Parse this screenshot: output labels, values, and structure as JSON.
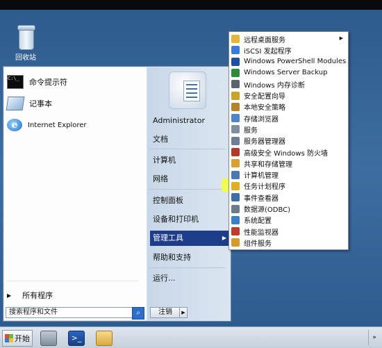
{
  "desktop": {
    "recycle_bin_label": "回收站"
  },
  "start_menu": {
    "pinned": [
      {
        "label": "命令提示符",
        "icon": "cmd-icon"
      },
      {
        "label": "记事本",
        "icon": "notepad-icon"
      },
      {
        "label": "Internet Explorer",
        "icon": "ie-icon"
      }
    ],
    "all_programs_label": "所有程序",
    "search_placeholder": "搜索程序和文件",
    "right_items": [
      "Administrator",
      "文档",
      "计算机",
      "网络",
      "控制面板",
      "设备和打印机",
      "管理工具",
      "帮助和支持",
      "运行..."
    ],
    "active_item": "管理工具",
    "logoff_label": "注销"
  },
  "admin_tools_submenu": {
    "items": [
      {
        "label": "远程桌面服务",
        "icon": "folder-icon",
        "color": "#e6b43a",
        "has_submenu": true
      },
      {
        "label": "iSCSI 发起程序",
        "icon": "iscsi-icon",
        "color": "#3b7bd8"
      },
      {
        "label": "Windows PowerShell Modules",
        "icon": "powershell-icon",
        "color": "#1f4fa5"
      },
      {
        "label": "Windows Server Backup",
        "icon": "backup-icon",
        "color": "#2f8a3b"
      },
      {
        "label": "Windows 内存诊断",
        "icon": "memory-icon",
        "color": "#5a6470"
      },
      {
        "label": "安全配置向导",
        "icon": "security-wizard-icon",
        "color": "#c9a227"
      },
      {
        "label": "本地安全策略",
        "icon": "local-policy-icon",
        "color": "#b5832c"
      },
      {
        "label": "存储浏览器",
        "icon": "storage-icon",
        "color": "#4f86c6"
      },
      {
        "label": "服务",
        "icon": "services-icon",
        "color": "#7f8f9f"
      },
      {
        "label": "服务器管理器",
        "icon": "server-manager-icon",
        "color": "#6c7e92"
      },
      {
        "label": "高级安全 Windows 防火墙",
        "icon": "firewall-icon",
        "color": "#b33a2a"
      },
      {
        "label": "共享和存储管理",
        "icon": "share-storage-icon",
        "color": "#d8a02e"
      },
      {
        "label": "计算机管理",
        "icon": "computer-mgmt-icon",
        "color": "#4a78b0"
      },
      {
        "label": "任务计划程序",
        "icon": "scheduler-icon",
        "color": "#e0b020"
      },
      {
        "label": "事件查看器",
        "icon": "event-viewer-icon",
        "color": "#3f6fa8"
      },
      {
        "label": "数据源(ODBC)",
        "icon": "odbc-icon",
        "color": "#6b7c8d"
      },
      {
        "label": "系统配置",
        "icon": "sysconfig-icon",
        "color": "#3c7fc9"
      },
      {
        "label": "性能监视器",
        "icon": "perf-monitor-icon",
        "color": "#c0392b"
      },
      {
        "label": "组件服务",
        "icon": "component-services-icon",
        "color": "#d79b2d"
      }
    ],
    "highlighted_item": "任务计划程序",
    "highlight_color": "#f3ff3a"
  },
  "taskbar": {
    "start_label": "开始",
    "pinned": [
      {
        "icon": "server-manager-icon"
      },
      {
        "icon": "powershell-icon"
      },
      {
        "icon": "explorer-folder-icon"
      }
    ]
  }
}
